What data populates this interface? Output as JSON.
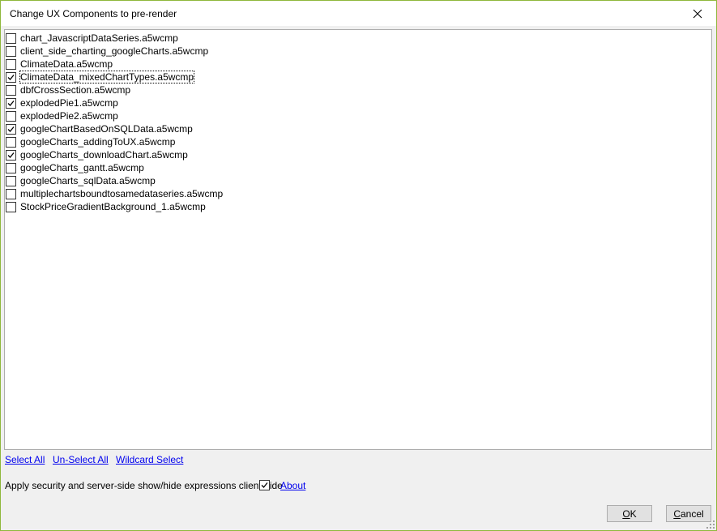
{
  "window": {
    "title": "Change UX Components to pre-render",
    "close_icon": "close-icon"
  },
  "list": {
    "items": [
      {
        "label": "chart_JavascriptDataSeries.a5wcmp",
        "checked": false,
        "focused": false
      },
      {
        "label": "client_side_charting_googleCharts.a5wcmp",
        "checked": false,
        "focused": false
      },
      {
        "label": "ClimateData.a5wcmp",
        "checked": false,
        "focused": false
      },
      {
        "label": "ClimateData_mixedChartTypes.a5wcmp",
        "checked": true,
        "focused": true
      },
      {
        "label": "dbfCrossSection.a5wcmp",
        "checked": false,
        "focused": false
      },
      {
        "label": "explodedPie1.a5wcmp",
        "checked": true,
        "focused": false
      },
      {
        "label": "explodedPie2.a5wcmp",
        "checked": false,
        "focused": false
      },
      {
        "label": "googleChartBasedOnSQLData.a5wcmp",
        "checked": true,
        "focused": false
      },
      {
        "label": "googleCharts_addingToUX.a5wcmp",
        "checked": false,
        "focused": false
      },
      {
        "label": "googleCharts_downloadChart.a5wcmp",
        "checked": true,
        "focused": false
      },
      {
        "label": "googleCharts_gantt.a5wcmp",
        "checked": false,
        "focused": false
      },
      {
        "label": "googleCharts_sqlData.a5wcmp",
        "checked": false,
        "focused": false
      },
      {
        "label": "multiplechartsboundtosamedataseries.a5wcmp",
        "checked": false,
        "focused": false
      },
      {
        "label": "StockPriceGradientBackground_1.a5wcmp",
        "checked": false,
        "focused": false
      }
    ]
  },
  "links": {
    "select_all": "Select All",
    "unselect_all": "Un-Select All",
    "wildcard_select": "Wildcard Select",
    "about": "About"
  },
  "options": {
    "apply_security_label": "Apply security and server-side show/hide expressions client-side",
    "apply_security_checked": true
  },
  "buttons": {
    "ok_mnemonic": "O",
    "ok_rest": "K",
    "cancel_mnemonic": "C",
    "cancel_rest": "ancel"
  },
  "colors": {
    "window_border": "#8fb83c",
    "link": "#0000ee",
    "list_background": "#ffffff",
    "dialog_background": "#f0f0f0"
  }
}
